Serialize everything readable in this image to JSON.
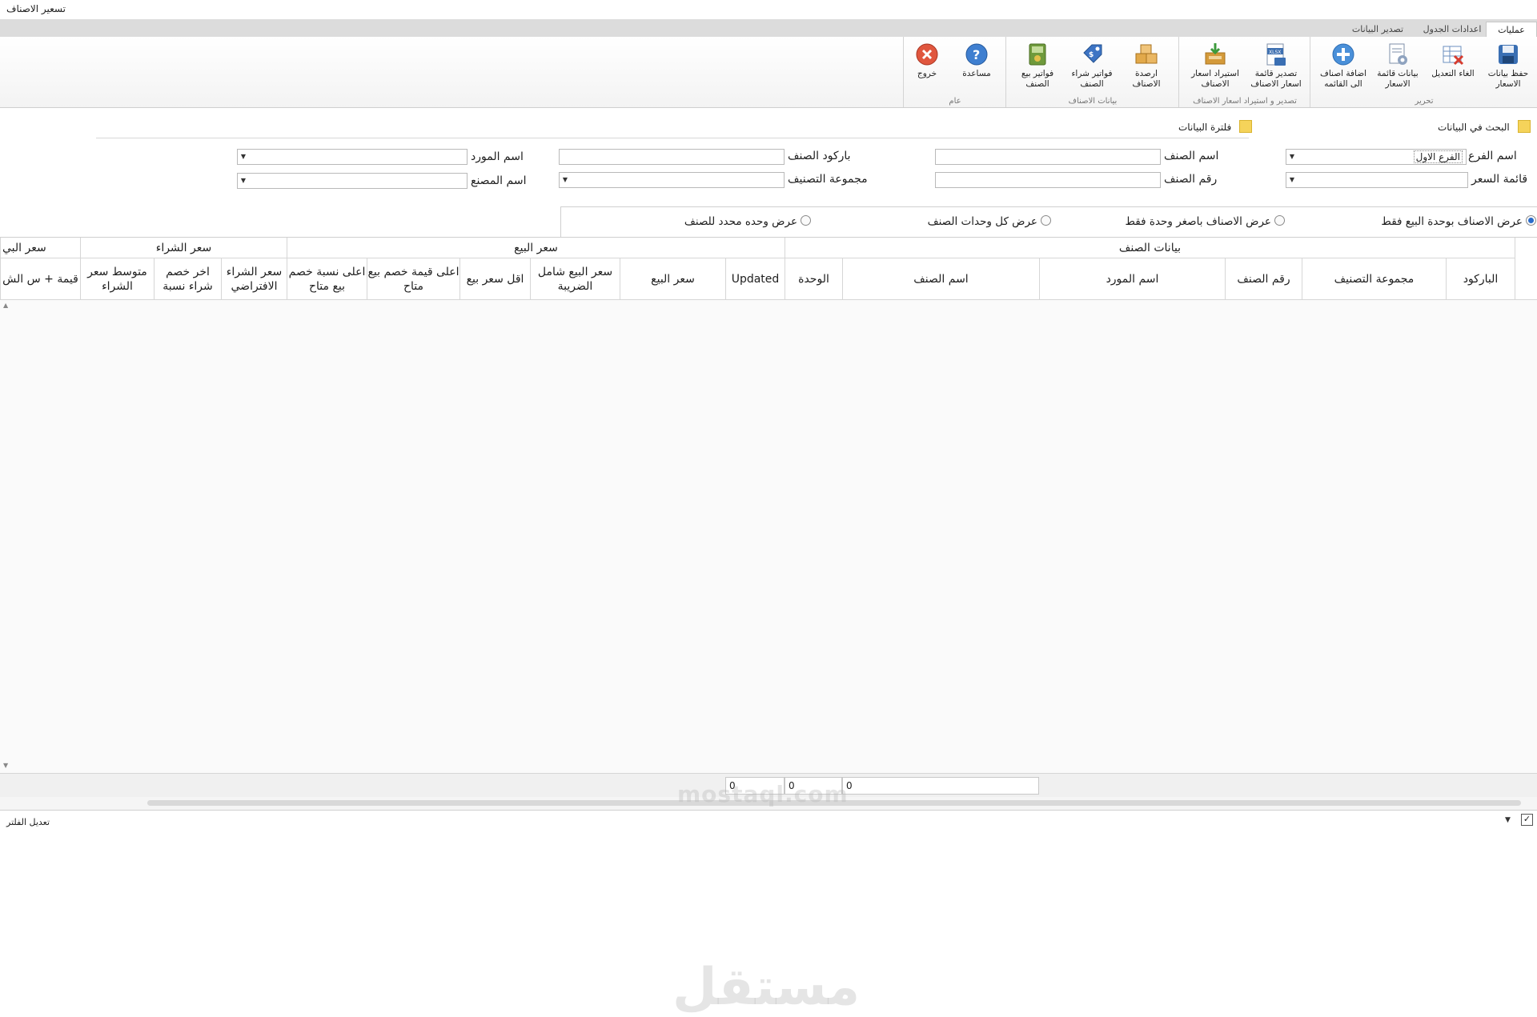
{
  "window_title": "تسعير الاصناف",
  "tabs": [
    "عمليات",
    "اعدادات الجدول",
    "تصدير البيانات"
  ],
  "ribbon": {
    "groups": [
      {
        "label": "تحرير",
        "buttons": [
          "حفظ بيانات الاسعار",
          "الغاء التعديل",
          "بيانات قائمة الاسعار",
          "اضافة اصناف الى القائمه"
        ]
      },
      {
        "label": "تصدير و استيراد اسعار الاصناف",
        "buttons": [
          "تصدير قائمة اسعار الاصناف",
          "استيراد اسعار الاصناف"
        ]
      },
      {
        "label": "بيانات الاصناف",
        "buttons": [
          "ارصدة الاصناف",
          "فواتير شراء الصنف",
          "فواتير بيع الصنف"
        ]
      },
      {
        "label": "عام",
        "buttons": [
          "مساعدة",
          "خروج"
        ]
      }
    ]
  },
  "sections": {
    "search": "البحث في البيانات",
    "filter": "فلترة البيانات"
  },
  "form": {
    "branch_label": "اسم الفرع",
    "branch_value": "الفرع الاول",
    "price_list_label": "قائمة السعر",
    "item_name_label": "اسم الصنف",
    "item_no_label": "رقم الصنف",
    "barcode_label": "باركود الصنف",
    "category_label": "مجموعة التصنيف",
    "supplier_label": "اسم المورد",
    "manufacturer_label": "اسم المصنع"
  },
  "radios": [
    {
      "label": "عرض الاصناف بوحدة البيع فقط",
      "selected": true
    },
    {
      "label": "عرض الاصناف باصغر وحدة فقط",
      "selected": false
    },
    {
      "label": "عرض كل وحدات الصنف",
      "selected": false
    },
    {
      "label": "عرض وحده محدد للصنف",
      "selected": false
    }
  ],
  "grid": {
    "bands": [
      "بيانات الصنف",
      "سعر البيع",
      "سعر الشراء",
      "سعر البي"
    ],
    "columns": [
      "الباركود",
      "مجموعة التصنيف",
      "رقم الصنف",
      "اسم المورد",
      "اسم الصنف",
      "الوحدة",
      "Updated",
      "سعر البيع",
      "سعر البيع شامل الضريبة",
      "اقل سعر بيع",
      "اعلى قيمة خصم بيع متاح",
      "اعلى نسبة خصم بيع متاح",
      "سعر الشراء الافتراضي",
      "اخر خصم شراء نسبة",
      "متوسط سعر الشراء",
      "قيمة + س الش"
    ],
    "footer_sums": [
      "0",
      "0",
      "0"
    ]
  },
  "status": {
    "filter_edit": "تعديل الفلتر"
  },
  "watermark": {
    "arabic": "مستقل",
    "latin": "mostaql.com"
  },
  "colors": {
    "tab_bar": "#dcdcdc",
    "accent_blue": "#2a6ccb",
    "section_yellow": "#f5d35a"
  }
}
